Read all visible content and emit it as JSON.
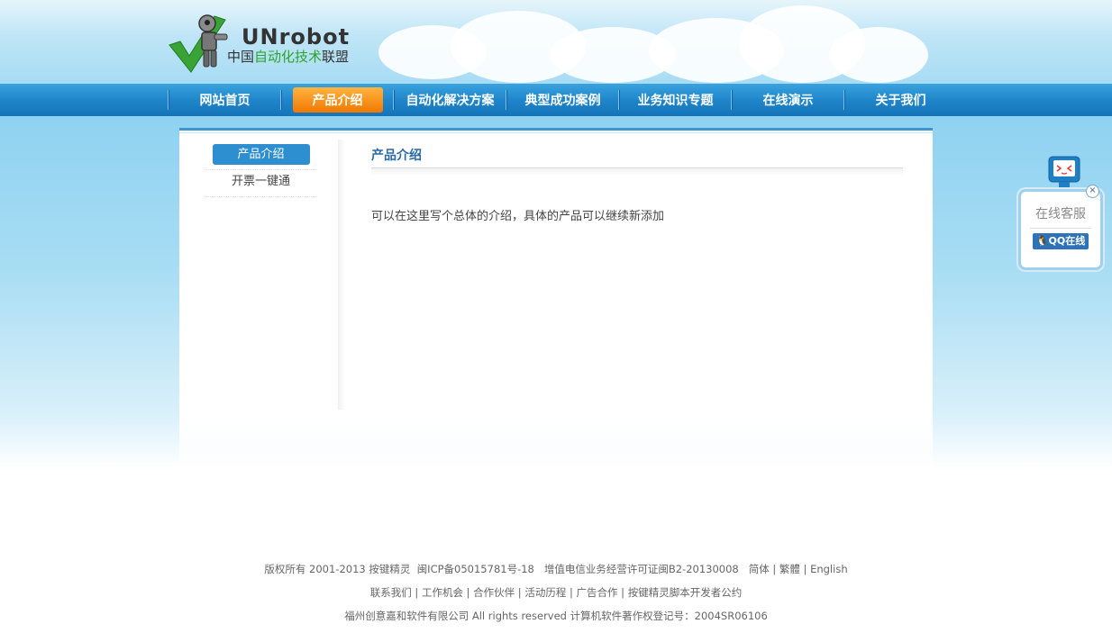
{
  "header": {
    "brand": "UNrobot",
    "tagline_prefix": "中国",
    "tagline_highlight": "自动化技术",
    "tagline_suffix": "联盟"
  },
  "nav": {
    "items": [
      {
        "label": "网站首页"
      },
      {
        "label": "产品介绍",
        "active": true
      },
      {
        "label": "自动化解决方案"
      },
      {
        "label": "典型成功案例"
      },
      {
        "label": "业务知识专题"
      },
      {
        "label": "在线演示"
      },
      {
        "label": "关于我们"
      }
    ]
  },
  "sidebar": {
    "items": [
      {
        "label": "产品介绍",
        "active": true
      },
      {
        "label": "开票一键通"
      }
    ]
  },
  "main": {
    "title": "产品介绍",
    "text": "可以在这里写个总体的介绍，具体的产品可以继续新添加"
  },
  "footer": {
    "line1": {
      "copyright": "版权所有 2001-2013 按键精灵",
      "icp": "闽ICP备05015781号-18",
      "license": "增值电信业务经营许可证闽B2-20130008",
      "lang_simplified": "简体",
      "lang_traditional": "繁體",
      "lang_english": "English"
    },
    "line2": {
      "links": [
        "联系我们",
        "工作机会",
        "合作伙伴",
        "活动历程",
        "广告合作",
        "按键精灵脚本开发者公约"
      ]
    },
    "line3": {
      "company": "福州创意嘉和软件有限公司 All rights reserved 计算机软件著作权登记号：2004SR06106"
    }
  },
  "service": {
    "title": "在线客服",
    "qq_label": "QQ在线",
    "close_symbol": "×"
  },
  "colors": {
    "nav_blue": "#1f86cb",
    "nav_active": "#f07800",
    "sidebar_active": "#2d8fcf",
    "title_blue": "#2a6aa6",
    "brand_green": "#2aa52a"
  }
}
